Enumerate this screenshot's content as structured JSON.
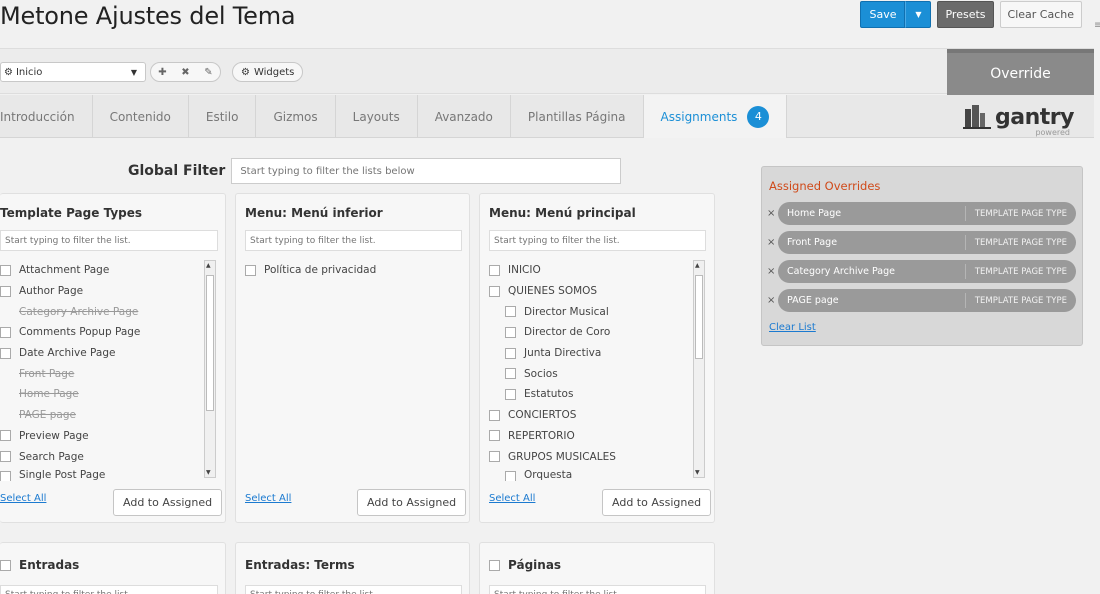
{
  "header": {
    "title": "Metone Ajustes del Tema",
    "save_label": "Save",
    "presets_label": "Presets",
    "clear_cache_label": "Clear Cache"
  },
  "toolbar": {
    "selected_page": "Inicio",
    "widgets_label": "Widgets",
    "override_label": "Override"
  },
  "tabs": [
    {
      "label": "Introducción"
    },
    {
      "label": "Contenido"
    },
    {
      "label": "Estilo"
    },
    {
      "label": "Gizmos"
    },
    {
      "label": "Layouts"
    },
    {
      "label": "Avanzado"
    },
    {
      "label": "Plantillas Página"
    },
    {
      "label": "Assignments",
      "badge": "4"
    }
  ],
  "logo": {
    "word": "gantry",
    "sub": "powered"
  },
  "global_filter": {
    "label": "Global Filter",
    "placeholder": "Start typing to filter the lists below"
  },
  "panels": [
    {
      "title": "Template Page Types",
      "filter_placeholder": "Start typing to filter the list.",
      "items": [
        "Attachment Page",
        "Author Page",
        "Category Archive Page",
        "Comments Popup Page",
        "Date Archive Page",
        "Front Page",
        "Home Page",
        "PAGE page",
        "Preview Page",
        "Search Page",
        "Single Post Page"
      ],
      "select_all": "Select All",
      "add_label": "Add to Assigned"
    },
    {
      "title": "Menu: Menú inferior",
      "filter_placeholder": "Start typing to filter the list.",
      "items": [
        "Política de privacidad"
      ],
      "select_all": "Select All",
      "add_label": "Add to Assigned"
    },
    {
      "title": "Menu: Menú principal",
      "filter_placeholder": "Start typing to filter the list.",
      "items": [
        "INICIO",
        "QUIENES SOMOS",
        "Director Musical",
        "Director de Coro",
        "Junta Directiva",
        "Socios",
        "Estatutos",
        "CONCIERTOS",
        "REPERTORIO",
        "GRUPOS MUSICALES",
        "Orquesta"
      ],
      "select_all": "Select All",
      "add_label": "Add to Assigned"
    }
  ],
  "bottom_panels": [
    {
      "title": "Entradas",
      "filter_placeholder": "Start typing to filter the list."
    },
    {
      "title": "Entradas: Terms",
      "filter_placeholder": "Start typing to filter the list."
    },
    {
      "title": "Páginas",
      "filter_placeholder": "Start typing to filter the list."
    }
  ],
  "assigned": {
    "title": "Assigned Overrides",
    "items": [
      {
        "name": "Home Page",
        "type": "TEMPLATE PAGE TYPE"
      },
      {
        "name": "Front Page",
        "type": "TEMPLATE PAGE TYPE"
      },
      {
        "name": "Category Archive Page",
        "type": "TEMPLATE PAGE TYPE"
      },
      {
        "name": "PAGE page",
        "type": "TEMPLATE PAGE TYPE"
      }
    ],
    "clear_label": "Clear List",
    "remove_glyph": "×"
  },
  "colors": {
    "accent": "#1b8fd6",
    "assigned_title": "#d04a1a",
    "override_bg": "#8a8a8a"
  }
}
